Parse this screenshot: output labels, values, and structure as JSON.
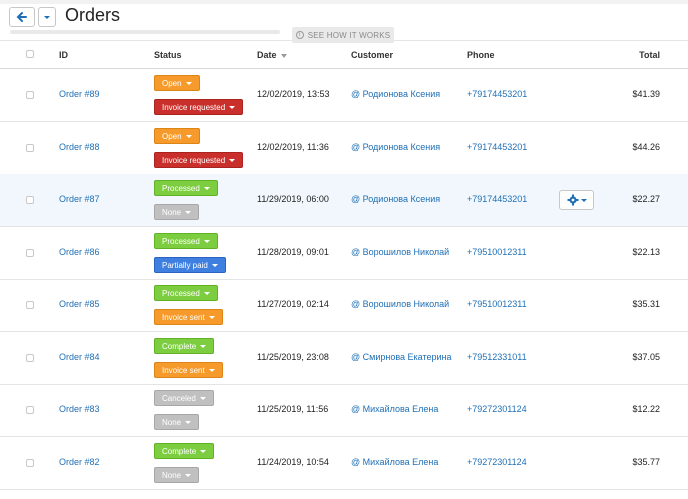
{
  "header": {
    "title": "Orders",
    "how_it_works": "SEE HOW IT WORKS"
  },
  "columns": {
    "id": "ID",
    "status": "Status",
    "date": "Date",
    "customer": "Customer",
    "phone": "Phone",
    "total": "Total"
  },
  "colors": {
    "accent": "#1f6fb5",
    "open": "#f59a2b",
    "invoice_requested": "#c9302c",
    "processed": "#7ccd3f",
    "none": "#c0c0c0",
    "partially_paid": "#3f7fe0"
  },
  "icons": [
    "arrow-left-icon",
    "chevron-down-icon",
    "gear-icon",
    "info-icon",
    "sort-icon",
    "checkbox"
  ],
  "rows": [
    {
      "id": "Order #89",
      "status1": "Open",
      "status1_color": "orange",
      "status2": "Invoice requested",
      "status2_color": "red",
      "date": "12/02/2019, 13:53",
      "customer": "@ Родионова Ксения",
      "phone": "+79174453201",
      "total": "$41.39"
    },
    {
      "id": "Order #88",
      "status1": "Open",
      "status1_color": "orange",
      "status2": "Invoice requested",
      "status2_color": "red",
      "date": "12/02/2019, 11:36",
      "customer": "@ Родионова Ксения",
      "phone": "+79174453201",
      "total": "$44.26"
    },
    {
      "id": "Order #87",
      "status1": "Processed",
      "status1_color": "green",
      "status2": "None",
      "status2_color": "gray",
      "date": "11/29/2019, 06:00",
      "customer": "@ Родионова Ксения",
      "phone": "+79174453201",
      "total": "$22.27"
    },
    {
      "id": "Order #86",
      "status1": "Processed",
      "status1_color": "green",
      "status2": "Partially paid",
      "status2_color": "blue",
      "date": "11/28/2019, 09:01",
      "customer": "@ Ворошилов Николай",
      "phone": "+79510012311",
      "total": "$22.13"
    },
    {
      "id": "Order #85",
      "status1": "Processed",
      "status1_color": "green",
      "status2": "Invoice sent",
      "status2_color": "orange",
      "date": "11/27/2019, 02:14",
      "customer": "@ Ворошилов Николай",
      "phone": "+79510012311",
      "total": "$35.31"
    },
    {
      "id": "Order #84",
      "status1": "Complete",
      "status1_color": "green",
      "status2": "Invoice sent",
      "status2_color": "orange",
      "date": "11/25/2019, 23:08",
      "customer": "@ Смирнова Екатерина",
      "phone": "+79512331011",
      "total": "$37.05"
    },
    {
      "id": "Order #83",
      "status1": "Canceled",
      "status1_color": "gray",
      "status2": "None",
      "status2_color": "gray",
      "date": "11/25/2019, 11:56",
      "customer": "@ Михайлова Елена",
      "phone": "+79272301124",
      "total": "$12.22"
    },
    {
      "id": "Order #82",
      "status1": "Complete",
      "status1_color": "green",
      "status2": "None",
      "status2_color": "gray",
      "date": "11/24/2019, 10:54",
      "customer": "@ Михайлова Елена",
      "phone": "+79272301124",
      "total": "$35.77"
    }
  ]
}
